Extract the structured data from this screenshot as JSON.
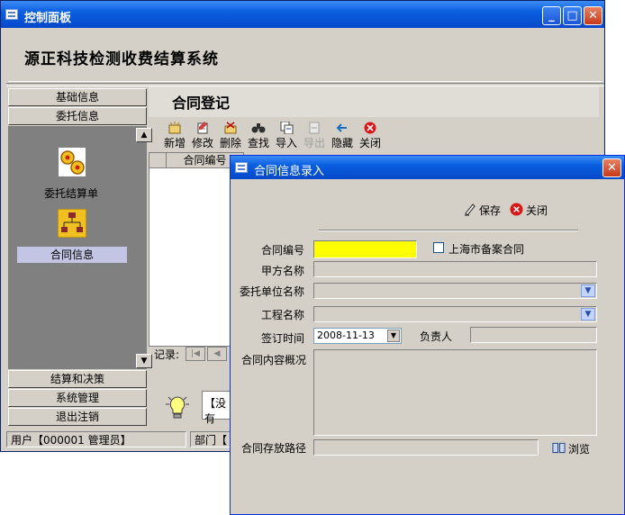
{
  "window": {
    "title": "控制面板"
  },
  "app": {
    "name": "源正科技检测收费结算系统"
  },
  "nav": {
    "top_buttons": [
      "基础信息",
      "委托信息"
    ],
    "items": [
      {
        "label": "委托结算单",
        "icon": "gears-icon",
        "selected": false
      },
      {
        "label": "合同信息",
        "icon": "org-chart-icon",
        "selected": true
      }
    ],
    "bottom_buttons": [
      "结算和决策",
      "系统管理",
      "退出注销"
    ]
  },
  "content": {
    "title": "合同登记",
    "toolbar": [
      {
        "label": "新增",
        "icon": "new-icon",
        "enabled": true
      },
      {
        "label": "修改",
        "icon": "edit-icon",
        "enabled": true
      },
      {
        "label": "删除",
        "icon": "delete-icon",
        "enabled": true
      },
      {
        "label": "查找",
        "icon": "binoculars-icon",
        "enabled": true
      },
      {
        "label": "导入",
        "icon": "import-icon",
        "enabled": true
      },
      {
        "label": "导出",
        "icon": "export-icon",
        "enabled": false
      },
      {
        "label": "隐藏",
        "icon": "hide-icon",
        "enabled": true
      },
      {
        "label": "关闭",
        "icon": "close-icon",
        "enabled": true
      }
    ],
    "grid_header": "合同编号",
    "record_label": "记录:",
    "hint_text": "【没有"
  },
  "status": {
    "user": "用户【000001 管理员】",
    "dept": "部门【"
  },
  "dialog": {
    "title": "合同信息录入",
    "save_label": "保存",
    "close_label": "关闭",
    "contract_no_label": "合同编号",
    "contract_no_value": "",
    "shanghai_checkbox_label": "上海市备案合同",
    "party_a_label": "甲方名称",
    "party_a_value": "",
    "client_label": "委托单位名称",
    "client_value": "",
    "project_label": "工程名称",
    "project_value": "",
    "sign_date_label": "签订时间",
    "sign_date_value": "2008-11-13",
    "owner_label": "负责人",
    "owner_value": "",
    "summary_label": "合同内容概况",
    "summary_value": "",
    "path_label": "合同存放路径",
    "path_value": "",
    "browse_label": "浏览"
  },
  "colors": {
    "title_bar": "#0a5fe0",
    "highlight_field": "#ffff00",
    "nav_panel": "#808080",
    "selected_item": "#c4c4e4"
  }
}
